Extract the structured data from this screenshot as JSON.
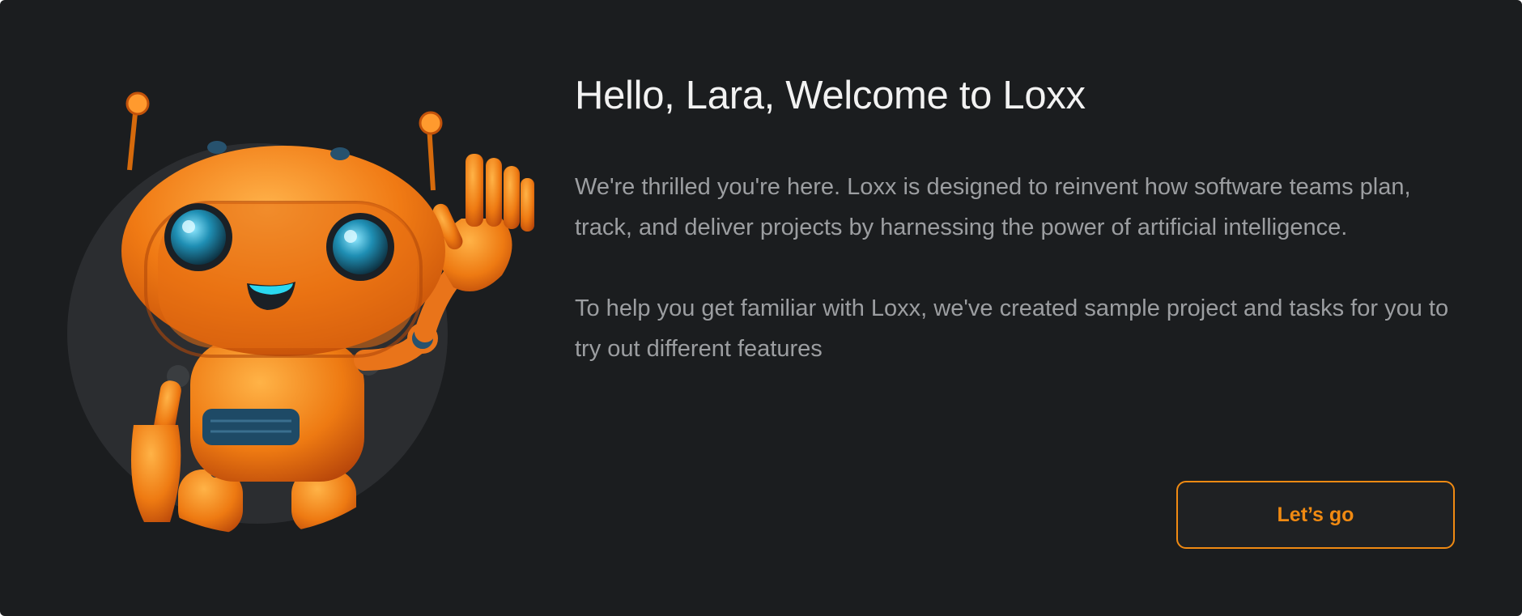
{
  "welcome": {
    "title": "Hello, Lara, Welcome to Loxx",
    "paragraphs": [
      "We're thrilled you're here. Loxx is designed to reinvent how software teams plan, track, and deliver projects by harnessing the power of artificial intelligence.",
      "To help you get familiar with Loxx, we've created sample project and tasks for you to try out different features"
    ],
    "cta_label": "Let’s go"
  },
  "colors": {
    "background": "#1b1d1f",
    "accent": "#f08a12",
    "title": "#f2f2f2",
    "body_text": "#9c9ea1"
  },
  "illustration": {
    "icon": "waving-robot-illustration"
  }
}
